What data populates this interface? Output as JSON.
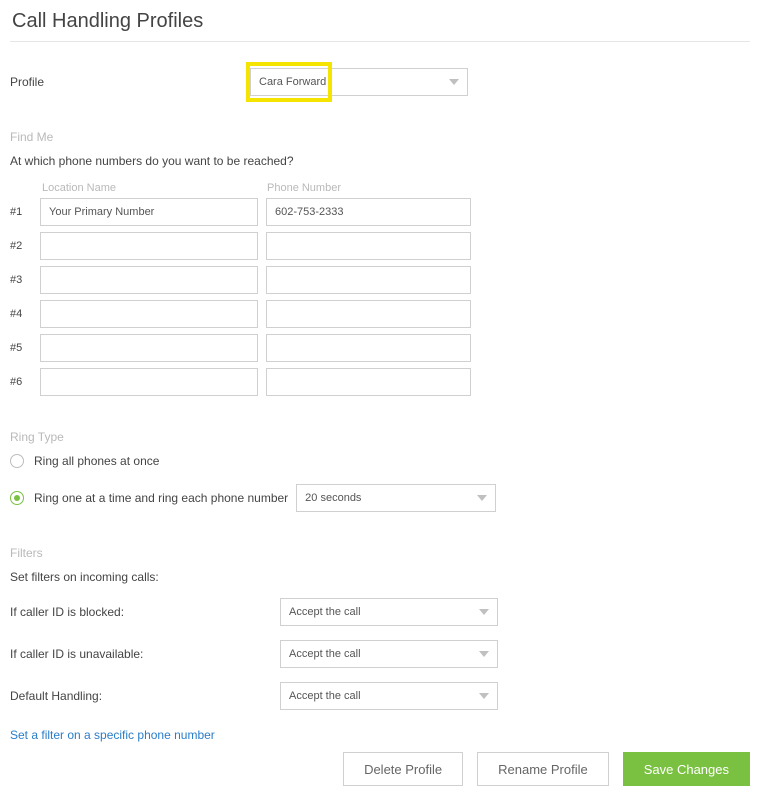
{
  "page_title": "Call Handling Profiles",
  "profile": {
    "label": "Profile",
    "selected": "Cara Forward"
  },
  "find_me": {
    "heading": "Find Me",
    "question": "At which phone numbers do you want to be reached?",
    "col_location": "Location Name",
    "col_phone": "Phone Number",
    "rows": [
      {
        "idx": "#1",
        "location": "Your Primary Number",
        "phone": "602-753-2333"
      },
      {
        "idx": "#2",
        "location": "",
        "phone": ""
      },
      {
        "idx": "#3",
        "location": "",
        "phone": ""
      },
      {
        "idx": "#4",
        "location": "",
        "phone": ""
      },
      {
        "idx": "#5",
        "location": "",
        "phone": ""
      },
      {
        "idx": "#6",
        "location": "",
        "phone": ""
      }
    ]
  },
  "ring_type": {
    "heading": "Ring Type",
    "opt_all": "Ring all phones at once",
    "opt_seq": "Ring one at a time and ring each phone number",
    "duration": "20 seconds"
  },
  "filters": {
    "heading": "Filters",
    "intro": "Set filters on incoming calls:",
    "blocked_label": "If caller ID is blocked:",
    "blocked_value": "Accept the call",
    "unavailable_label": "If caller ID is unavailable:",
    "unavailable_value": "Accept the call",
    "default_label": "Default Handling:",
    "default_value": "Accept the call",
    "link": "Set a filter on a specific phone number"
  },
  "buttons": {
    "delete": "Delete Profile",
    "rename": "Rename Profile",
    "save": "Save Changes"
  }
}
